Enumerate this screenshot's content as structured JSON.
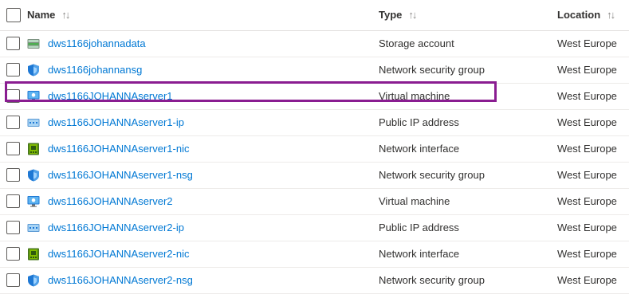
{
  "columns": {
    "name": "Name",
    "type": "Type",
    "location": "Location",
    "sort_glyph": "↑↓"
  },
  "colors": {
    "link": "#0078d4",
    "highlight": "#8a1d91"
  },
  "rows": [
    {
      "name": "dws1166johannadata",
      "type": "Storage account",
      "location": "West Europe",
      "icon": "storage-account-icon"
    },
    {
      "name": "dws1166johannansg",
      "type": "Network security group",
      "location": "West Europe",
      "icon": "network-security-group-icon"
    },
    {
      "name": "dws1166JOHANNAserver1",
      "type": "Virtual machine",
      "location": "West Europe",
      "icon": "virtual-machine-icon",
      "highlighted": true
    },
    {
      "name": "dws1166JOHANNAserver1-ip",
      "type": "Public IP address",
      "location": "West Europe",
      "icon": "public-ip-icon"
    },
    {
      "name": "dws1166JOHANNAserver1-nic",
      "type": "Network interface",
      "location": "West Europe",
      "icon": "network-interface-icon"
    },
    {
      "name": "dws1166JOHANNAserver1-nsg",
      "type": "Network security group",
      "location": "West Europe",
      "icon": "network-security-group-icon"
    },
    {
      "name": "dws1166JOHANNAserver2",
      "type": "Virtual machine",
      "location": "West Europe",
      "icon": "virtual-machine-icon"
    },
    {
      "name": "dws1166JOHANNAserver2-ip",
      "type": "Public IP address",
      "location": "West Europe",
      "icon": "public-ip-icon"
    },
    {
      "name": "dws1166JOHANNAserver2-nic",
      "type": "Network interface",
      "location": "West Europe",
      "icon": "network-interface-icon"
    },
    {
      "name": "dws1166JOHANNAserver2-nsg",
      "type": "Network security group",
      "location": "West Europe",
      "icon": "network-security-group-icon"
    }
  ]
}
